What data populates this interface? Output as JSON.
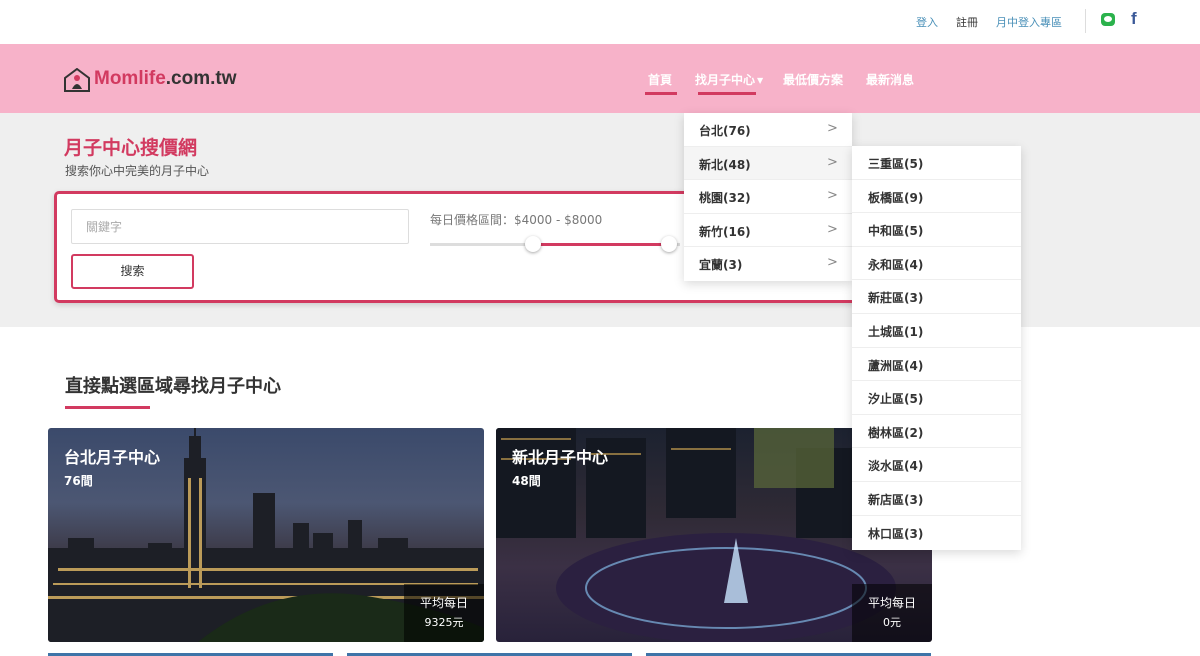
{
  "topbar": {
    "login": "登入",
    "register": "註冊",
    "center_login": "月中登入專區",
    "social": [
      "line-icon",
      "facebook-icon"
    ]
  },
  "header": {
    "logo_brand": "Momlife",
    "logo_domain": ".com.tw",
    "nav": [
      {
        "label": "首頁"
      },
      {
        "label": "找月子中心"
      },
      {
        "label": "最低價方案"
      },
      {
        "label": "最新消息"
      }
    ]
  },
  "hero": {
    "title": "月子中心搜價網",
    "subtitle": "搜索你心中完美的月子中心",
    "keyword_placeholder": "關鍵字",
    "search_button": "搜索",
    "price_label": "每日價格區間：$4000 - $8000"
  },
  "regions_section": {
    "title": "直接點選區域尋找月子中心",
    "cards": [
      {
        "title": "台北月子中心",
        "count": "76間",
        "avg_label": "平均每日",
        "avg_value": "9325元"
      },
      {
        "title": "新北月子中心",
        "count": "48間",
        "avg_label": "平均每日",
        "avg_value": "0元"
      }
    ]
  },
  "dropdown": {
    "items": [
      {
        "label": "台北(76)"
      },
      {
        "label": "新北(48)"
      },
      {
        "label": "桃園(32)"
      },
      {
        "label": "新竹(16)"
      },
      {
        "label": "宜蘭(3)"
      }
    ],
    "submenu": [
      {
        "label": "三重區(5)"
      },
      {
        "label": "板橋區(9)"
      },
      {
        "label": "中和區(5)"
      },
      {
        "label": "永和區(4)"
      },
      {
        "label": "新莊區(3)"
      },
      {
        "label": "土城區(1)"
      },
      {
        "label": "蘆洲區(4)"
      },
      {
        "label": "汐止區(5)"
      },
      {
        "label": "樹林區(2)"
      },
      {
        "label": "淡水區(4)"
      },
      {
        "label": "新店區(3)"
      },
      {
        "label": "林口區(3)"
      }
    ]
  },
  "colors": {
    "brand": "#d23a60",
    "header_bg": "#f7b2c9",
    "hero_bg": "#efefef"
  }
}
